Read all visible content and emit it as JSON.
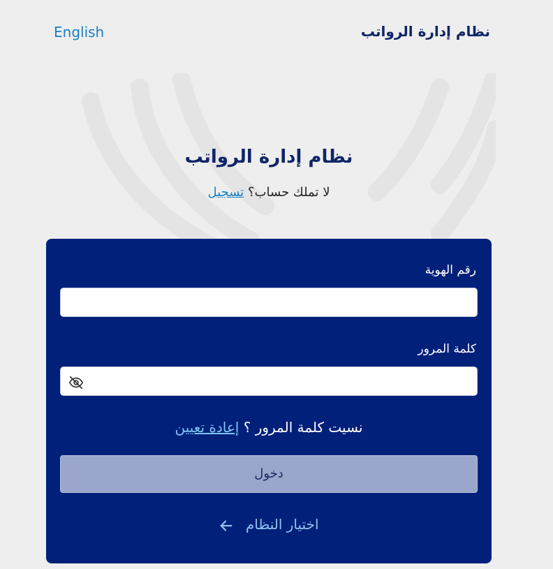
{
  "topbar": {
    "language_label": "English",
    "brand_title": "نظام إدارة الرواتب"
  },
  "hero": {
    "title": "نظام إدارة الرواتب",
    "no_account_text": "لا تملك حساب؟",
    "signup_link": "تسجيل"
  },
  "form": {
    "id_label": "رقم الهوية",
    "id_value": "",
    "password_label": "كلمة المرور",
    "password_value": "",
    "forgot_text": "نسيت كلمة المرور ؟",
    "reset_link": "إعادة تعيين",
    "login_button": "دخول",
    "choose_system_link": "اختيار النظام"
  },
  "icons": {
    "password_toggle": "eye-off-icon",
    "back": "arrow-left-icon"
  },
  "colors": {
    "background": "#eeeeee",
    "card": "#00207a",
    "brand_text": "#0f2566",
    "link": "#1a7fc4",
    "card_link": "#7ec6f5",
    "button_disabled": "#9aa7ca"
  }
}
